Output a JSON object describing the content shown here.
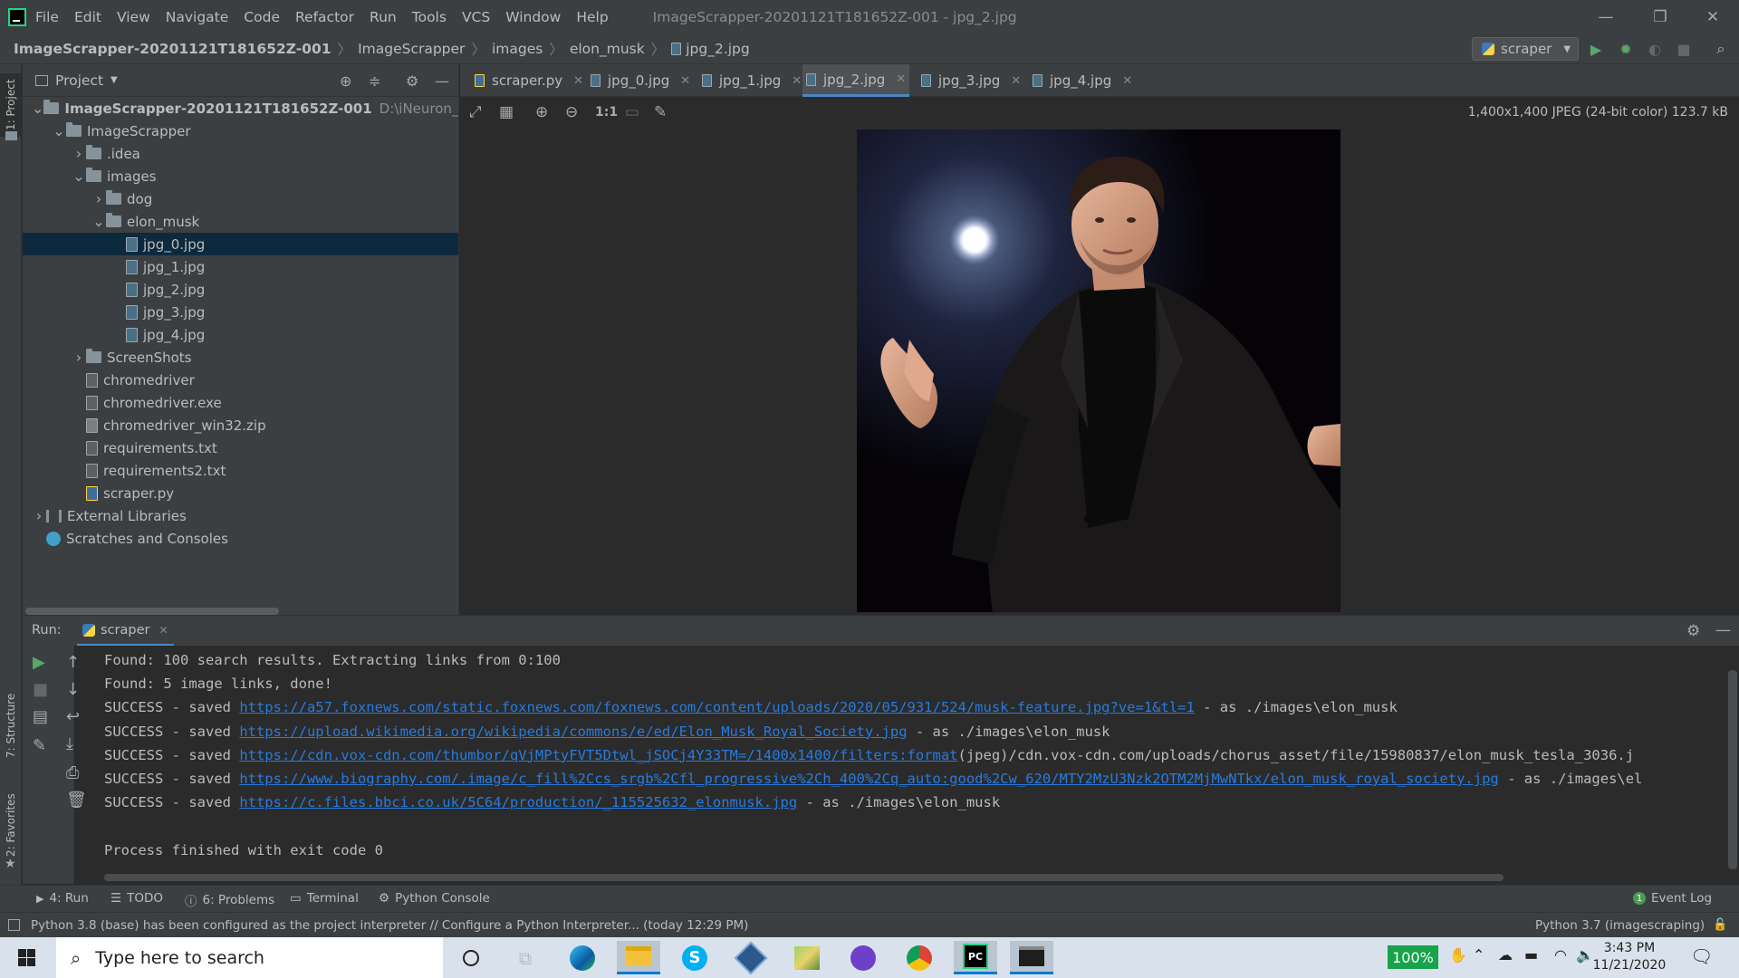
{
  "window": {
    "title": "ImageScrapper-20201121T181652Z-001 - jpg_2.jpg",
    "menu": [
      "File",
      "Edit",
      "View",
      "Navigate",
      "Code",
      "Refactor",
      "Run",
      "Tools",
      "VCS",
      "Window",
      "Help"
    ],
    "controls": {
      "minimize": "—",
      "restore": "❐",
      "close": "✕"
    }
  },
  "breadcrumb": [
    "ImageScrapper-20201121T181652Z-001",
    "ImageScrapper",
    "images",
    "elon_musk",
    "jpg_2.jpg"
  ],
  "run_config": {
    "label": "scraper"
  },
  "left_stripe": {
    "project_tab": "1: Project",
    "structure_tab": "7: Structure",
    "favorites_tab": "2: Favorites"
  },
  "project_panel": {
    "title": "Project",
    "tree": [
      {
        "label": "ImageScrapper-20201121T181652Z-001",
        "path": "D:\\iNeuron_Machine",
        "kind": "folder",
        "depth": 0,
        "expanded": true,
        "bold": true
      },
      {
        "label": "ImageScrapper",
        "kind": "folder",
        "depth": 1,
        "expanded": true
      },
      {
        "label": ".idea",
        "kind": "folder",
        "depth": 2,
        "expanded": false
      },
      {
        "label": "images",
        "kind": "folder",
        "depth": 2,
        "expanded": true
      },
      {
        "label": "dog",
        "kind": "folder",
        "depth": 3,
        "expanded": false
      },
      {
        "label": "elon_musk",
        "kind": "folder",
        "depth": 3,
        "expanded": true
      },
      {
        "label": "jpg_0.jpg",
        "kind": "img",
        "depth": 4,
        "selected": true
      },
      {
        "label": "jpg_1.jpg",
        "kind": "img",
        "depth": 4
      },
      {
        "label": "jpg_2.jpg",
        "kind": "img",
        "depth": 4
      },
      {
        "label": "jpg_3.jpg",
        "kind": "img",
        "depth": 4
      },
      {
        "label": "jpg_4.jpg",
        "kind": "img",
        "depth": 4
      },
      {
        "label": "ScreenShots",
        "kind": "folder",
        "depth": 2,
        "expanded": false
      },
      {
        "label": "chromedriver",
        "kind": "file",
        "depth": 2
      },
      {
        "label": "chromedriver.exe",
        "kind": "file",
        "depth": 2
      },
      {
        "label": "chromedriver_win32.zip",
        "kind": "zip",
        "depth": 2
      },
      {
        "label": "requirements.txt",
        "kind": "file",
        "depth": 2
      },
      {
        "label": "requirements2.txt",
        "kind": "file",
        "depth": 2
      },
      {
        "label": "scraper.py",
        "kind": "py",
        "depth": 2
      },
      {
        "label": "External Libraries",
        "kind": "lib",
        "depth": 0,
        "expanded": false
      },
      {
        "label": "Scratches and Consoles",
        "kind": "scratch",
        "depth": 0
      }
    ]
  },
  "editor_tabs": [
    {
      "label": "scraper.py",
      "active": false
    },
    {
      "label": "jpg_0.jpg",
      "active": false
    },
    {
      "label": "jpg_1.jpg",
      "active": false
    },
    {
      "label": "jpg_2.jpg",
      "active": true
    },
    {
      "label": "jpg_3.jpg",
      "active": false
    },
    {
      "label": "jpg_4.jpg",
      "active": false
    }
  ],
  "image_viewer": {
    "info": "1,400x1,400 JPEG (24-bit color) 123.7 kB",
    "zoom_actual_label": "1:1"
  },
  "run_panel": {
    "label": "Run:",
    "tab": "scraper",
    "console": [
      {
        "prefix": "Found: 100 search results. Extracting links from 0:100",
        "link": "",
        "suffix": ""
      },
      {
        "prefix": "Found: 5 image links, done!",
        "link": "",
        "suffix": ""
      },
      {
        "prefix": "SUCCESS - saved ",
        "link": "https://a57.foxnews.com/static.foxnews.com/foxnews.com/content/uploads/2020/05/931/524/musk-feature.jpg?ve=1&tl=1",
        "suffix": " - as ./images\\elon_musk"
      },
      {
        "prefix": "SUCCESS - saved ",
        "link": "https://upload.wikimedia.org/wikipedia/commons/e/ed/Elon_Musk_Royal_Society.jpg",
        "suffix": " - as ./images\\elon_musk"
      },
      {
        "prefix": "SUCCESS - saved ",
        "link": "https://cdn.vox-cdn.com/thumbor/qVjMPtyFVT5Dtwl_jSOCj4Y33TM=/1400x1400/filters:format",
        "suffix": "(jpeg)/cdn.vox-cdn.com/uploads/chorus_asset/file/15980837/elon_musk_tesla_3036.j"
      },
      {
        "prefix": "SUCCESS - saved ",
        "link": "https://www.biography.com/.image/c_fill%2Ccs_srgb%2Cfl_progressive%2Ch_400%2Cq_auto:good%2Cw_620/MTY2MzU3Nzk2OTM2MjMwNTkx/elon_musk_royal_society.jpg",
        "suffix": " - as ./images\\el"
      },
      {
        "prefix": "SUCCESS - saved ",
        "link": "https://c.files.bbci.co.uk/5C64/production/_115525632_elonmusk.jpg",
        "suffix": " - as ./images\\elon_musk"
      },
      {
        "prefix": "",
        "link": "",
        "suffix": ""
      },
      {
        "prefix": "Process finished with exit code 0",
        "link": "",
        "suffix": ""
      }
    ]
  },
  "bottom_tabs": {
    "run": "4: Run",
    "todo": "TODO",
    "problems": "6: Problems",
    "terminal": "Terminal",
    "python_console": "Python Console",
    "event_log": "Event Log",
    "event_count": "1"
  },
  "status_bar": {
    "message": "Python 3.8 (base) has been configured as the project interpreter // Configure a Python Interpreter... (today 12:29 PM)",
    "interpreter": "Python 3.7 (imagescraping)"
  },
  "taskbar": {
    "search_placeholder": "Type here to search",
    "battery": "100%",
    "time": "3:43 PM",
    "date": "11/21/2020"
  }
}
